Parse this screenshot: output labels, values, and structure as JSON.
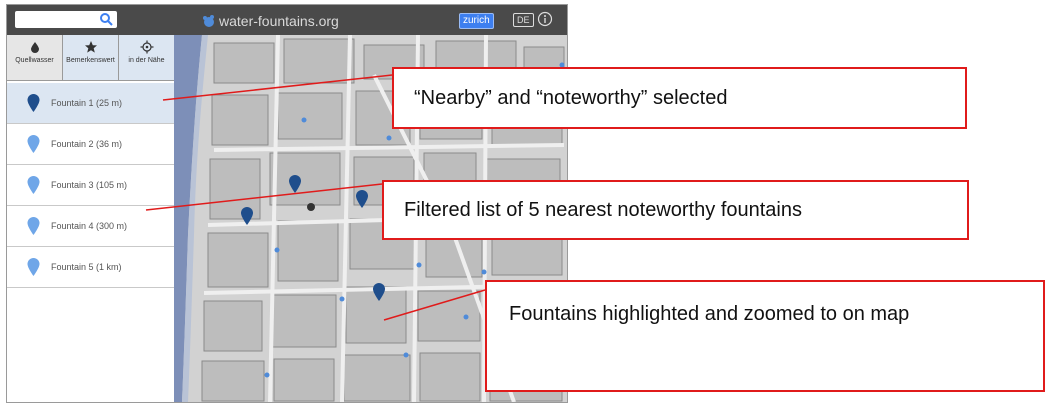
{
  "topbar": {
    "search_placeholder": "",
    "brand_text": "water-fountains.org",
    "city_button": "zurich",
    "lang_button": "DE",
    "icons": {
      "search": "search-icon",
      "brand": "fountain-logo-icon",
      "info": "info-icon"
    }
  },
  "filters": [
    {
      "label": "Quellwasser",
      "icon": "drop-icon",
      "selected": false
    },
    {
      "label": "Bemerkenswert",
      "icon": "star-icon",
      "selected": true
    },
    {
      "label": "in der Nähe",
      "icon": "crosshair-icon",
      "selected": true
    }
  ],
  "fountains": [
    {
      "label": "Fountain 1 (25 m)",
      "selected": true
    },
    {
      "label": "Fountain 2 (36 m)",
      "selected": false
    },
    {
      "label": "Fountain 3 (105 m)",
      "selected": false
    },
    {
      "label": "Fountain 4 (300 m)",
      "selected": false
    },
    {
      "label": "Fountain 5 (1 km)",
      "selected": false
    }
  ],
  "callouts": {
    "filters": "“Nearby” and “noteworthy” selected",
    "list": "Filtered list of 5 nearest noteworthy fountains",
    "map": "Fountains highlighted and zoomed to on map"
  },
  "colors": {
    "accent": "#3d7ff0",
    "callout_border": "#e01b1b",
    "pin_dark": "#1f4e8c",
    "pin_light": "#6fa6e8",
    "selected_bg": "#dce6f2",
    "topbar": "#4a4a4a"
  }
}
